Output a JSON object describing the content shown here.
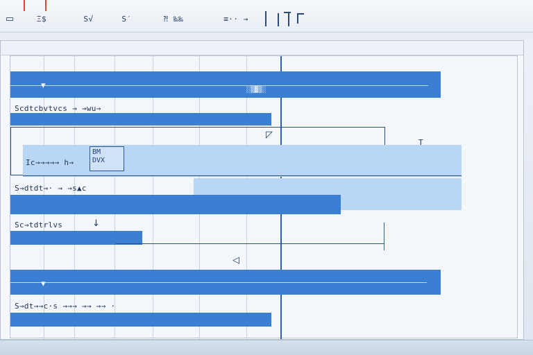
{
  "toolbar": {
    "buttons": [
      {
        "name": "first",
        "text": "☰"
      },
      {
        "name": "second",
        "text": "≣"
      },
      {
        "name": "third",
        "text": "⁂"
      }
    ],
    "labels": [
      "Ξ$",
      "S√",
      "S′",
      "⁈ ‰‰",
      "≡·· →"
    ]
  },
  "rows": [
    {
      "label": "Scdtcbvtvcs → →wu→"
    },
    {
      "label": "S→dtdt→· → →s▲c"
    },
    {
      "label": "Sc→tdtrlvs"
    },
    {
      "label": "S→dt→→c·s →→→ →→ →→ ·"
    }
  ],
  "selection": {
    "chip_text": "BM\nDVX",
    "field_text": "Ic→→→→→ h→"
  },
  "annotations": {
    "top_tag": "░▒▓▒░",
    "mid_tag": "→",
    "right_tag": "T"
  },
  "colors": {
    "accent": "#3b7fd3",
    "accent_light": "#b9d6f4",
    "line": "#2f5fa5"
  }
}
